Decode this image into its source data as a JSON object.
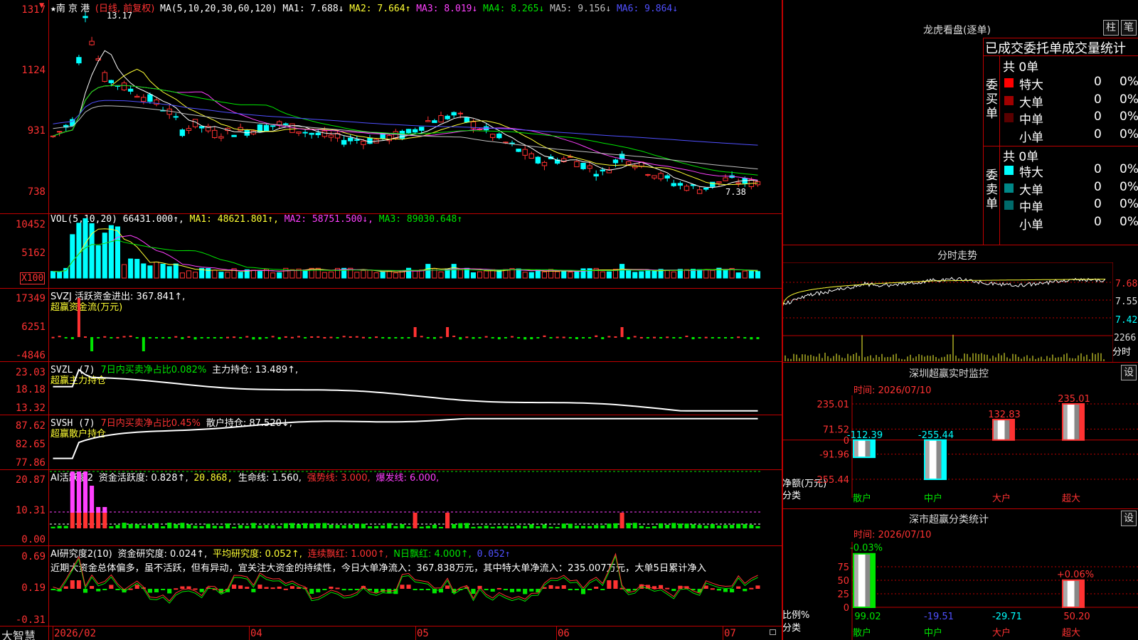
{
  "header": {
    "star": "★",
    "stock_name": "南 京 港",
    "mode": "(日线, 前复权)",
    "ma_label": "MA(5,10,20,30,60,120)",
    "ma": [
      {
        "label": "MA1: 7.688↓",
        "color": "#ffffff"
      },
      {
        "label": "MA2: 7.664↑",
        "color": "#ffff33"
      },
      {
        "label": "MA3: 8.019↓",
        "color": "#ff40ff"
      },
      {
        "label": "MA4: 8.265↓",
        "color": "#00e600"
      },
      {
        "label": "MA5: 9.156↓",
        "color": "#c0c0c0"
      },
      {
        "label": "MA6: 9.864↓",
        "color": "#5050ff"
      }
    ],
    "high_label": "13.17",
    "low_label": "7.38"
  },
  "price_axis": [
    "1317",
    "1124",
    "931",
    "738"
  ],
  "vol": {
    "title": "VOL(5,10,20)",
    "value": "66431.000↑,",
    "ma1": "MA1: 48621.801↑,",
    "ma2": "MA2: 58751.500↓,",
    "ma3": "MA3: 89030.648↑",
    "axis": [
      "10452",
      "5162",
      "X100"
    ]
  },
  "svzj": {
    "title": "SVZJ  活跃资金进出: 367.841↑,",
    "subtitle": "超赢资金流(万元)",
    "axis": [
      "17349",
      "6251",
      "-4846"
    ]
  },
  "svzl": {
    "title_a": "SVZL (7)",
    "title_b": "7日内买卖净占比0.082%",
    "title_c": "主力持仓: 13.489↑,",
    "subtitle": "超赢主力持仓",
    "axis": [
      "23.03",
      "18.18",
      "13.32"
    ]
  },
  "svsh": {
    "title_a": "SVSH (7)",
    "title_b": "7日内买卖净占比0.45%",
    "title_c": "散户持仓: 87.520↓,",
    "subtitle": "超赢散户持仓",
    "axis": [
      "87.62",
      "82.65",
      "77.86"
    ]
  },
  "ai_active": {
    "title_a": "AI活跃度2",
    "title_b": "资金活跃度: 0.828↑,",
    "title_c": "20.868,",
    "title_d": "生命线: 1.560,",
    "title_e": "强势线: 3.000,",
    "title_f": "爆发线: 6.000,",
    "axis": [
      "20.87",
      "10.31",
      "0.00"
    ]
  },
  "ai_research": {
    "title_a": "AI研究度2(10)",
    "title_b": "资金研究度: 0.024↑,",
    "title_c": "平均研究度: 0.052↑,",
    "title_d": "连续飘红: 1.000↑,",
    "title_e": "N日飘红: 4.000↑,",
    "title_f": "0.052↑",
    "comment": "近期大资金总体偏多，虽不活跃，但有异动，宜关注大资金的持续性，今日大单净流入：367.838万元，其中特大单净流入：235.007万元，大单5日累计净入",
    "axis": [
      "0.69",
      "0.19",
      "-0.31"
    ]
  },
  "date_axis": [
    "2026/02",
    "04",
    "05",
    "06",
    "07"
  ],
  "brand": "大智慧",
  "dragon_tiger": {
    "title": "龙虎看盘(逐单)",
    "btn_a": "柱",
    "btn_b": "笔",
    "subheader": "已成交委托单成交量统计",
    "buy_label": "委买单",
    "sell_label": "委卖单",
    "buy_total": "共 0单",
    "sell_total": "共 0单",
    "buy_rows": [
      {
        "name": "特大",
        "count": "0",
        "pct": "0%",
        "color": "#ff0000"
      },
      {
        "name": "大单",
        "count": "0",
        "pct": "0%",
        "color": "#a00000"
      },
      {
        "name": "中单",
        "count": "0",
        "pct": "0%",
        "color": "#5a0000"
      },
      {
        "name": "小单",
        "count": "0",
        "pct": "0%",
        "color": "#000000"
      }
    ],
    "sell_rows": [
      {
        "name": "特大",
        "count": "0",
        "pct": "0%",
        "color": "#00ffff"
      },
      {
        "name": "大单",
        "count": "0",
        "pct": "0%",
        "color": "#008888"
      },
      {
        "name": "中单",
        "count": "0",
        "pct": "0%",
        "color": "#006a6a"
      },
      {
        "name": "小单",
        "count": "0",
        "pct": "0%",
        "color": "#000000"
      }
    ]
  },
  "intraday": {
    "title": "分时走势",
    "axis": [
      "7.68",
      "7.55",
      "7.42",
      "2266"
    ],
    "unit": "分时"
  },
  "sz_monitor": {
    "title": "深圳超赢实时监控",
    "btn": "设",
    "time": "时间: 2026/07/10",
    "axis": [
      "235.01",
      "71.52",
      "0",
      "-91.96",
      "-255.44"
    ],
    "ylabel": "净额(万元)",
    "xlabel": "分类",
    "categories": [
      "散户",
      "中户",
      "大户",
      "超大"
    ],
    "values": [
      -112.39,
      -255.44,
      132.83,
      235.01
    ],
    "value_labels": [
      "-112.39",
      "-255.44",
      "132.83",
      "235.01"
    ]
  },
  "sz_stats": {
    "title": "深市超赢分类统计",
    "btn": "设",
    "time": "时间: 2026/07/10",
    "axis": [
      "75",
      "50",
      "25",
      "0"
    ],
    "ylabel": "比例%",
    "xlabel": "分类",
    "categories": [
      "散户",
      "中户",
      "大户",
      "超大"
    ],
    "change_labels": [
      "-0.03%",
      "",
      "",
      "+0.06%"
    ],
    "values": [
      99.02,
      -19.51,
      -29.71,
      50.2
    ],
    "value_labels": [
      "99.02",
      "-19.51",
      "-29.71",
      "50.20"
    ]
  }
}
